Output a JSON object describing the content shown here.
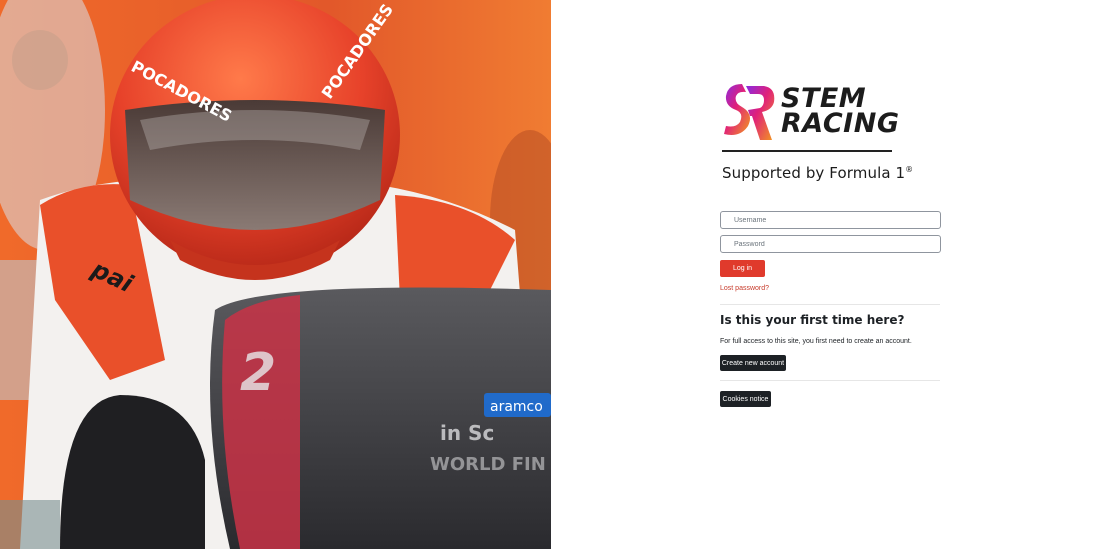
{
  "hero": {
    "alt": "Pit crew member in orange helmet",
    "helmet_text": "POCADORES",
    "badge_text": "aramco",
    "brand_text": "pai",
    "number_text": "2",
    "sponsor_line": "in Sc",
    "world_text": "WORLD FIN"
  },
  "brand": {
    "name_line1": "STEM",
    "name_line2": "RACING",
    "tagline": "Supported by Formula 1",
    "tagline_mark": "®"
  },
  "login": {
    "username_placeholder": "Username",
    "password_placeholder": "Password",
    "login_label": "Log in",
    "lost_password": "Lost password?"
  },
  "signup": {
    "heading": "Is this your first time here?",
    "description": "For full access to this site, you first need to create an account.",
    "create_label": "Create new account"
  },
  "footer": {
    "cookies_label": "Cookies notice"
  },
  "colors": {
    "accent": "#e03a2c",
    "dark_button": "#1d2125",
    "helmet_orange": "#e8542a"
  }
}
